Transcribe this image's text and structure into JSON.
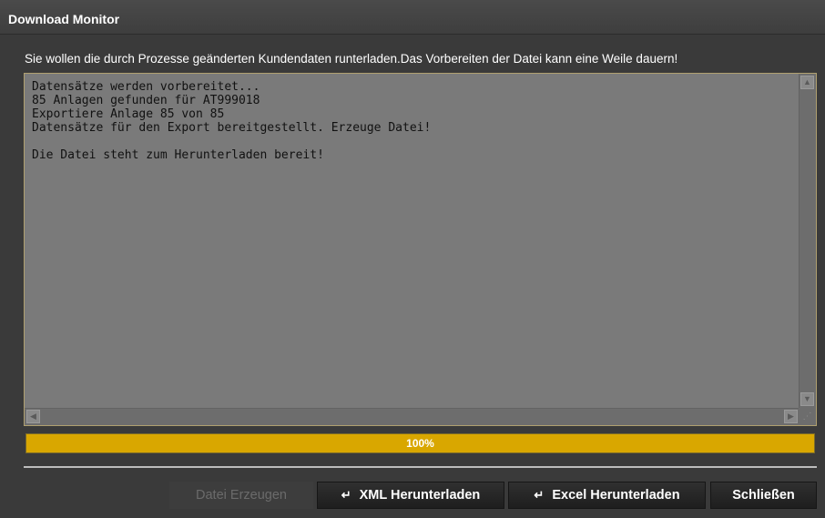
{
  "window": {
    "title": "Download Monitor"
  },
  "message": "Sie wollen die durch Prozesse geänderten Kundendaten runterladen.Das Vorbereiten der Datei kann eine Weile dauern!",
  "log": {
    "lines": [
      "Datensätze werden vorbereitet...",
      "85 Anlagen gefunden für AT999018",
      "Exportiere Anlage 85 von 85",
      "Datensätze für den Export bereitgestellt. Erzeuge Datei!",
      "",
      "Die Datei steht zum Herunterladen bereit!"
    ]
  },
  "progress": {
    "value": 1.0,
    "label": "100%",
    "color": "#d9a700"
  },
  "buttons": {
    "create_file": "Datei Erzeugen",
    "xml_download": "XML Herunterladen",
    "excel_download": "Excel Herunterladen",
    "close": "Schließen",
    "download_icon": "return-arrow-icon"
  }
}
